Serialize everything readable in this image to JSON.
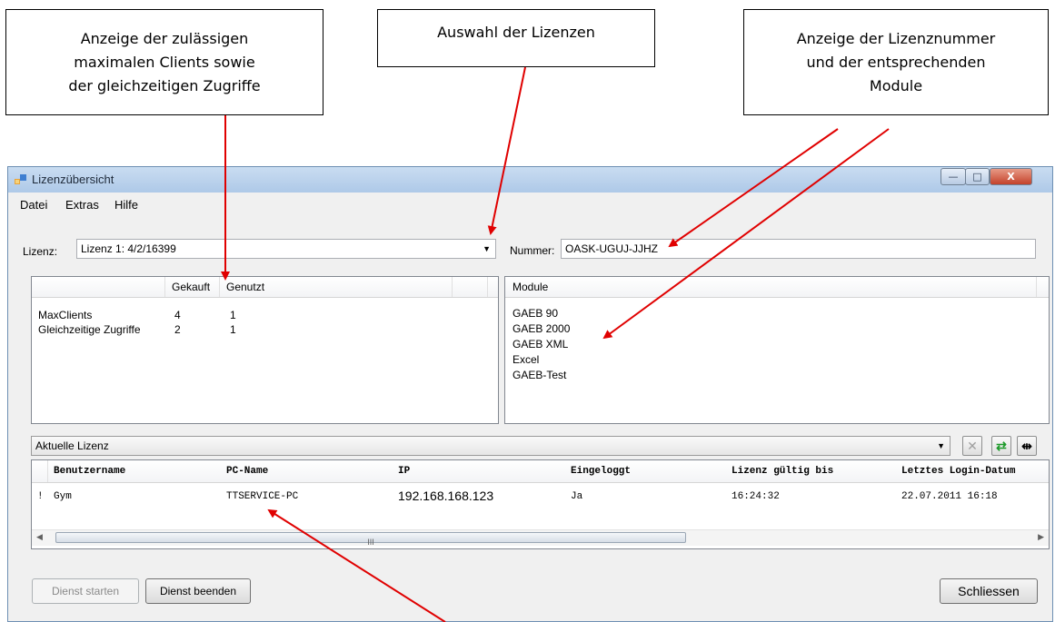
{
  "callouts": {
    "clients": {
      "lines": [
        "Anzeige der zulässigen",
        "maximalen Clients sowie",
        "der gleichzeitigen Zugriffe"
      ]
    },
    "licenses": {
      "lines": [
        "Auswahl der Lizenzen"
      ]
    },
    "number": {
      "lines": [
        "Anzeige der Lizenznummer",
        "und der entsprechenden",
        "Module"
      ]
    }
  },
  "window": {
    "title": "Lizenzübersicht",
    "controls": {
      "minimize": "—",
      "maximize": "□",
      "close": "X"
    }
  },
  "menu": [
    "Datei",
    "Extras",
    "Hilfe"
  ],
  "license": {
    "label": "Lizenz:",
    "selected": "Lizenz 1: 4/2/16399",
    "number_label": "Nummer:",
    "number_value": "OASK-UGUJ-JJHZ"
  },
  "clients_table": {
    "columns": [
      "",
      "Gekauft",
      "Genutzt"
    ],
    "rows": [
      {
        "name": "MaxClients",
        "bought": "4",
        "used": "1"
      },
      {
        "name": "Gleichzeitige Zugriffe",
        "bought": "2",
        "used": "1"
      }
    ]
  },
  "modules": {
    "header": "Module",
    "items": [
      "GAEB 90",
      "GAEB 2000",
      "GAEB XML",
      "Excel",
      "GAEB-Test"
    ]
  },
  "filter": {
    "selected": "Aktuelle Lizenz"
  },
  "sessions": {
    "columns": [
      "Benutzername",
      "PC-Name",
      "IP",
      "Eingeloggt",
      "Lizenz gültig bis",
      "Letztes Login-Datum"
    ],
    "rows": [
      {
        "marker": "!",
        "user": "Gym",
        "pc": "TTSERVICE-PC",
        "ip": "192.168.168.123",
        "logged_in": "Ja",
        "valid_until": "16:24:32",
        "last_login": "22.07.2011 16:18"
      }
    ],
    "scroll_grip": "III"
  },
  "buttons": {
    "start": "Dienst starten",
    "stop": "Dienst beenden",
    "close": "Schliessen"
  },
  "colors": {
    "arrow": "#e00000",
    "titlebar": "#b9d1ea",
    "close_button": "#c4422b"
  }
}
